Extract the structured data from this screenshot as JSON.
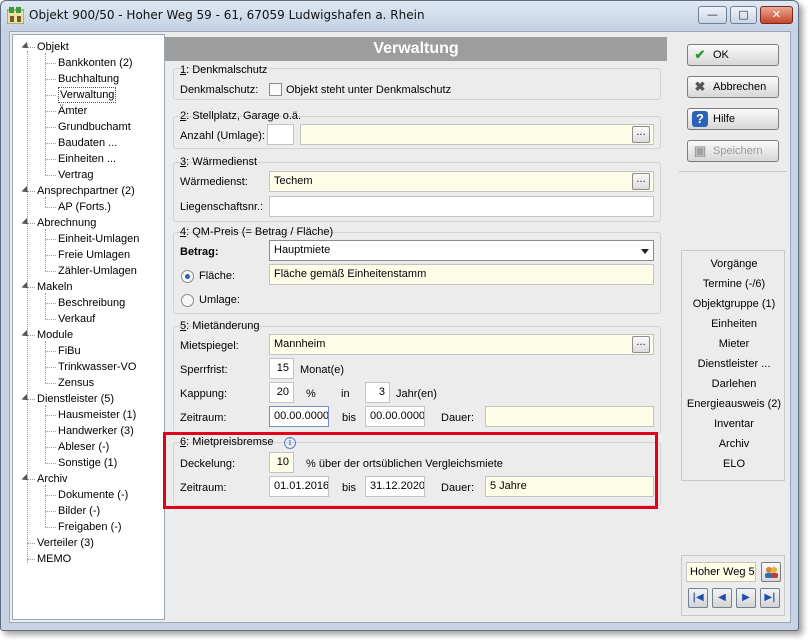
{
  "window": {
    "title": "Objekt 900/50 - Hoher Weg 59 - 61, 67059 Ludwigshafen a. Rhein",
    "minimize": "—",
    "maximize": "□",
    "close": "✕"
  },
  "tree": {
    "items": [
      {
        "label": "Objekt",
        "level": 0,
        "expander": true
      },
      {
        "label": "Bankkonten (2)",
        "level": 1
      },
      {
        "label": "Buchhaltung",
        "level": 1
      },
      {
        "label": "Verwaltung",
        "level": 1,
        "selected": true
      },
      {
        "label": "Ämter",
        "level": 1
      },
      {
        "label": "Grundbuchamt",
        "level": 1
      },
      {
        "label": "Baudaten ...",
        "level": 1
      },
      {
        "label": "Einheiten ...",
        "level": 1
      },
      {
        "label": "Vertrag",
        "level": 1
      },
      {
        "label": "Ansprechpartner (2)",
        "level": 0,
        "expander": true
      },
      {
        "label": "AP (Forts.)",
        "level": 1
      },
      {
        "label": "Abrechnung",
        "level": 0,
        "expander": true
      },
      {
        "label": "Einheit-Umlagen",
        "level": 1
      },
      {
        "label": "Freie Umlagen",
        "level": 1
      },
      {
        "label": "Zähler-Umlagen",
        "level": 1
      },
      {
        "label": "Makeln",
        "level": 0,
        "expander": true
      },
      {
        "label": "Beschreibung",
        "level": 1
      },
      {
        "label": "Verkauf",
        "level": 1
      },
      {
        "label": "Module",
        "level": 0,
        "expander": true
      },
      {
        "label": "FiBu",
        "level": 1
      },
      {
        "label": "Trinkwasser-VO",
        "level": 1
      },
      {
        "label": "Zensus",
        "level": 1
      },
      {
        "label": "Dienstleister (5)",
        "level": 0,
        "expander": true
      },
      {
        "label": "Hausmeister (1)",
        "level": 1
      },
      {
        "label": "Handwerker (3)",
        "level": 1
      },
      {
        "label": "Ableser (-)",
        "level": 1
      },
      {
        "label": "Sonstige (1)",
        "level": 1
      },
      {
        "label": "Archiv",
        "level": 0,
        "expander": true
      },
      {
        "label": "Dokumente (-)",
        "level": 1
      },
      {
        "label": "Bilder (-)",
        "level": 1
      },
      {
        "label": "Freigaben (-)",
        "level": 1
      },
      {
        "label": "Verteiler (3)",
        "level": 0
      },
      {
        "label": "MEMO",
        "level": 0
      }
    ]
  },
  "main": {
    "header": "Verwaltung",
    "denkmal": {
      "title_num": "1",
      "title_rest": ": Denkmalschutz",
      "label": "Denkmalschutz:",
      "checkbox_label": "Objekt steht unter Denkmalschutz",
      "checked": false
    },
    "stellplatz": {
      "title_num": "2",
      "title_rest": ": Stellplatz, Garage o.ä.",
      "label": "Anzahl (Umlage):",
      "count": "",
      "value": "",
      "dots": "..."
    },
    "waerme": {
      "title_num": "3",
      "title_rest": ": Wärmedienst",
      "label": "Wärmedienst:",
      "value": "Techem",
      "dots": "...",
      "liegenschaft_label": "Liegenschaftsnr.:",
      "liegenschaft_value": ""
    },
    "qm": {
      "title_num": "4",
      "title_rest": ": QM-Preis (= Betrag / Fläche)",
      "betrag_label": "Betrag:",
      "betrag_value": "Hauptmiete",
      "flaeche_label": "Fläche:",
      "flaeche_value": "Fläche gemäß Einheitenstamm",
      "umlage_label": "Umlage:",
      "selected": "Fläche"
    },
    "mietaenderung": {
      "title_num": "5",
      "title_rest": ": Mietänderung",
      "mietspiegel_label": "Mietspiegel:",
      "mietspiegel_value": "Mannheim",
      "dots": "...",
      "sperrfrist_label": "Sperrfrist:",
      "sperrfrist_value": "15",
      "sperrfrist_unit": "Monat(e)",
      "kappung_label": "Kappung:",
      "kappung_value": "20",
      "kappung_unit": "%",
      "in_label": "in",
      "jahre_value": "3",
      "jahre_unit": "Jahr(en)",
      "zeitraum_label": "Zeitraum:",
      "von": "00.00.0000",
      "bis_label": "bis",
      "bis": "00.00.0000",
      "dauer_label": "Dauer:",
      "dauer": ""
    },
    "mietpreisbremse": {
      "title_num": "6",
      "title_rest": ": Mietpreisbremse",
      "info_icon": "i",
      "deckelung_label": "Deckelung:",
      "deckelung_value": "10",
      "deckelung_text": "% über der ortsüblichen Vergleichsmiete",
      "zeitraum_label": "Zeitraum:",
      "von": "01.01.2016",
      "bis_label": "bis",
      "bis": "31.12.2020",
      "dauer_label": "Dauer:",
      "dauer": "5 Jahre"
    }
  },
  "sidebar": {
    "ok": "OK",
    "abbrechen": "Abbrechen",
    "hilfe": "Hilfe",
    "speichern": "Speichern",
    "links": [
      "Vorgänge",
      "Termine (-/6)",
      "Objektgruppe (1)",
      "Einheiten",
      "Mieter",
      "Dienstleister ...",
      "Darlehen",
      "Energieausweis (2)",
      "Inventar",
      "Archiv",
      "ELO"
    ],
    "nav_field": "Hoher Weg 5",
    "nav_first": "|◀",
    "nav_prev": "◀",
    "nav_next": "▶",
    "nav_last": "▶|"
  },
  "colors": {
    "highlight": "#e2001a",
    "header_bg": "#9d9d9d",
    "field_yellow": "#fefde8"
  }
}
